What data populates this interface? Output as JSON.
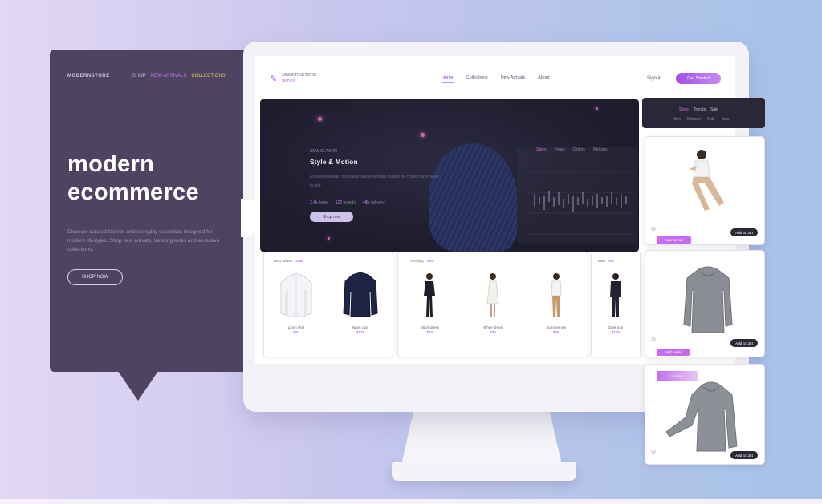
{
  "left": {
    "brand": "MODERNSTORE",
    "brand_links": [
      "SHOP",
      "NEW ARRIVALS",
      "COLLECTIONS"
    ],
    "title": "modern\necommerce",
    "description": "Discover curated fashion and everyday essentials designed for modern lifestyles. Shop new arrivals, trending looks and exclusive collections.",
    "button": "SHOP NOW"
  },
  "nav": {
    "logo": "MODERNSTORE",
    "logo_sub": "fashion",
    "links": [
      "Home",
      "Collections",
      "New Arrivals",
      "About"
    ],
    "signin": "Sign in",
    "cta": "Get Started"
  },
  "hero": {
    "eyebrow": "NEW SEASON",
    "title": "Style & Motion",
    "text": "Explore knitwear, outerwear and essentials crafted for comfort and made to last.",
    "stats": [
      {
        "value": "2.4k",
        "label": "items"
      },
      {
        "value": "120",
        "label": "brands"
      },
      {
        "value": "48h",
        "label": "delivery"
      }
    ],
    "button": "Shop now",
    "chart_tabs": [
      "Sales",
      "Views",
      "Orders",
      "Returns"
    ]
  },
  "products": [
    {
      "head": "Best sellers",
      "tag": "Sale",
      "items": [
        {
          "name": "Linen shirt",
          "price": "$49"
        },
        {
          "name": "Navy coat",
          "price": "$129"
        }
      ]
    },
    {
      "head": "Trending",
      "tag": "New",
      "items": [
        {
          "name": "Black dress",
          "price": "$79"
        },
        {
          "name": "White dress",
          "price": "$89"
        },
        {
          "name": "Summer set",
          "price": "$69"
        }
      ]
    },
    {
      "head": "Men",
      "tag": "Hot",
      "items": [
        {
          "name": "Dark suit",
          "price": "$199"
        }
      ]
    }
  ],
  "right": {
    "top_row1": [
      "Shop",
      "Trends",
      "Sale"
    ],
    "top_row2": [
      "Men",
      "Women",
      "Kids",
      "New"
    ],
    "cards": [
      {
        "badge": "New arrival",
        "button": "Add to cart"
      },
      {
        "badge": "Best seller",
        "button": "Add to cart"
      },
      {
        "badge": "Limited",
        "button": "Add to cart"
      }
    ]
  },
  "colors": {
    "accent": "#a24ee6",
    "panel": "#4e4461",
    "dark": "#1d1c2d"
  }
}
